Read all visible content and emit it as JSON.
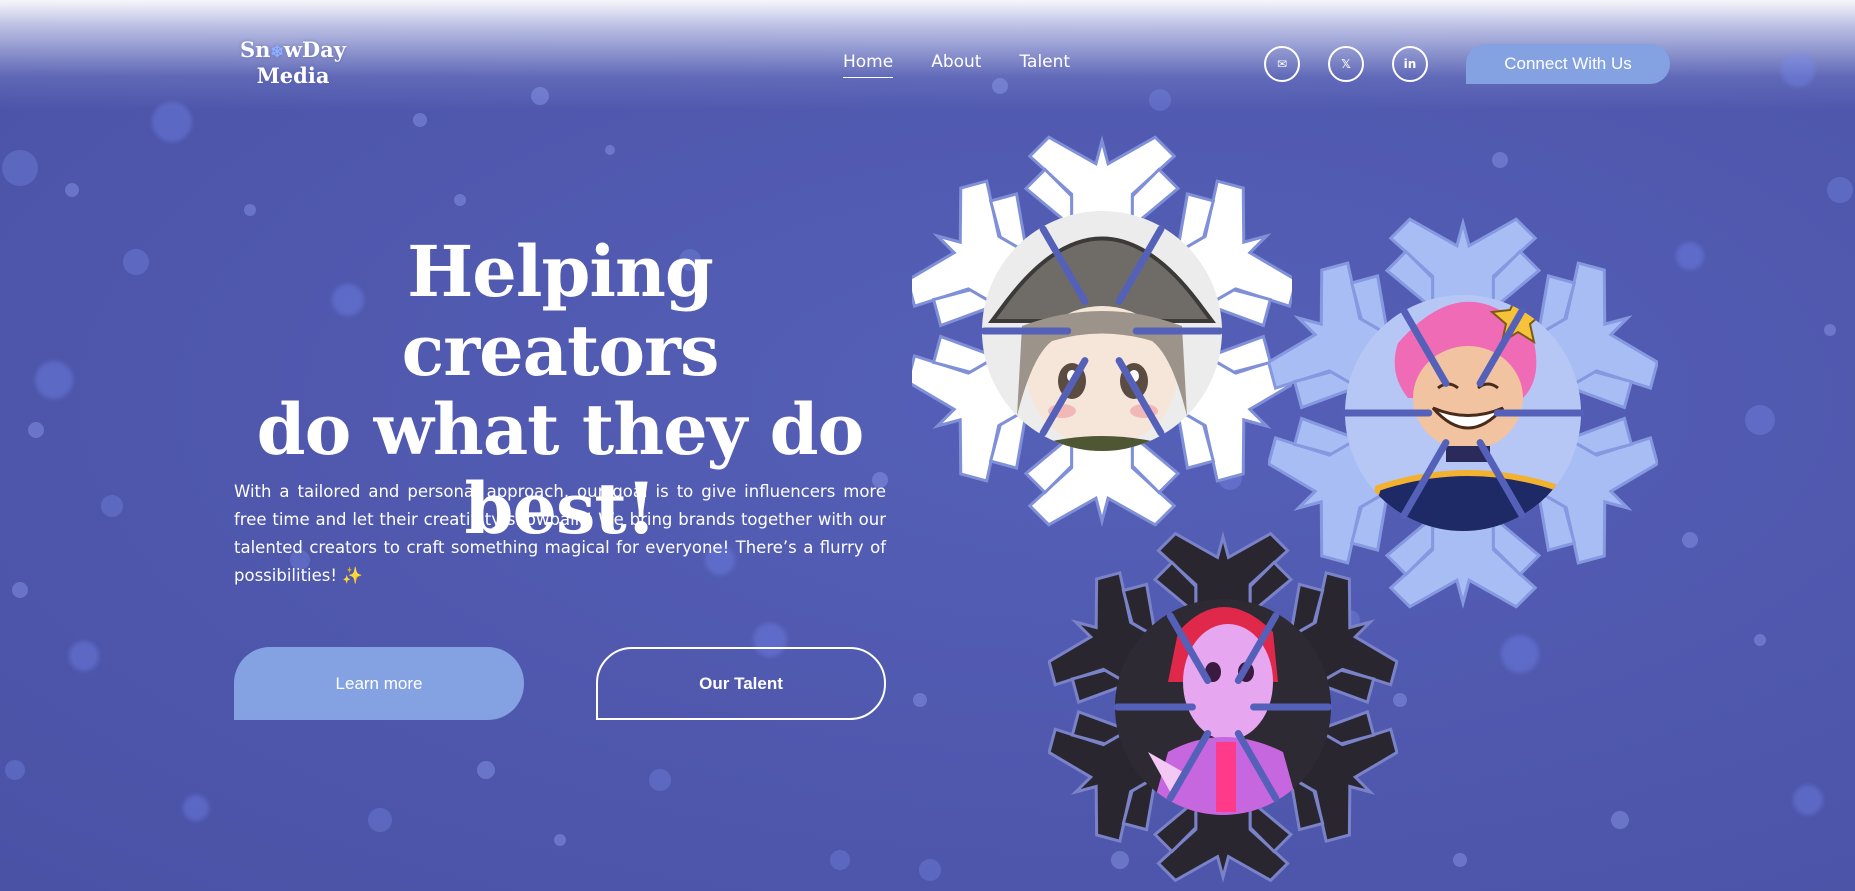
{
  "header": {
    "logo_line1": "Sn",
    "logo_flake": "❄",
    "logo_line1_rest": "wDay",
    "logo_line2": "Media",
    "nav": [
      {
        "label": "Home",
        "active": true
      },
      {
        "label": "About",
        "active": false
      },
      {
        "label": "Talent",
        "active": false
      }
    ],
    "social": [
      {
        "icon": "mail-icon",
        "glyph": "✉"
      },
      {
        "icon": "x-icon",
        "glyph": "𝕏"
      },
      {
        "icon": "linkedin-icon",
        "glyph": "in"
      }
    ],
    "cta_label": "Connect With Us"
  },
  "hero": {
    "headline_line1": "Helping creators",
    "headline_line2": "do what they do",
    "headline_line3": "best!",
    "paragraph": "With a tailored and personal approach, our goal is to give influencers more free time and let their creativity snowball!! We bring brands together with our talented creators to craft something magical for everyone! There’s a flurry of possibilities!",
    "sparkle": "✨",
    "learn_more_label": "Learn more",
    "our_talent_label": "Our Talent"
  },
  "colors": {
    "background": "#5159b0",
    "accent": "#84a2e2",
    "flake_white": "#ffffff",
    "flake_blue": "#a9bdf5",
    "flake_dark": "#2a2630"
  }
}
